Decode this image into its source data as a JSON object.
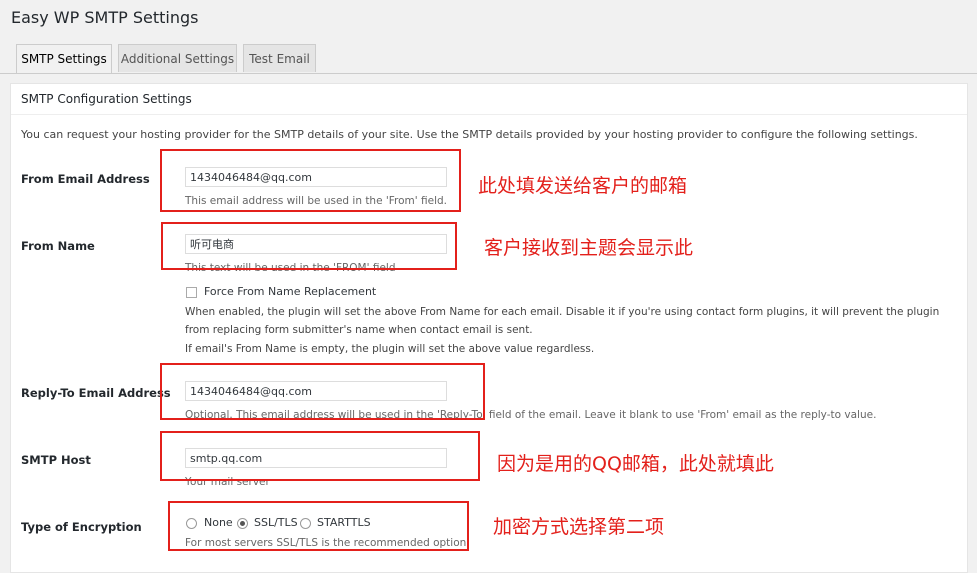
{
  "page": {
    "title": "Easy WP SMTP Settings"
  },
  "tabs": [
    {
      "label": "SMTP Settings",
      "active": true
    },
    {
      "label": "Additional Settings",
      "active": false
    },
    {
      "label": "Test Email",
      "active": false
    }
  ],
  "section": {
    "title": "SMTP Configuration Settings",
    "intro": "You can request your hosting provider for the SMTP details of your site. Use the SMTP details provided by your hosting provider to configure the following settings."
  },
  "fields": {
    "from_email": {
      "label": "From Email Address",
      "value": "1434046484@qq.com",
      "desc": "This email address will be used in the 'From' field."
    },
    "from_name": {
      "label": "From Name",
      "value": "听可电商",
      "desc": "This text will be used in the 'FROM' field",
      "force_label": "Force From Name Replacement",
      "force_checked": false,
      "help_1": "When enabled, the plugin will set the above From Name for each email. Disable it if you're using contact form plugins, it will prevent the plugin",
      "help_2": "from replacing form submitter's name when contact email is sent.",
      "help_3": "If email's From Name is empty, the plugin will set the above value regardless."
    },
    "reply_to": {
      "label": "Reply-To Email Address",
      "value": "1434046484@qq.com",
      "desc": "Optional. This email address will be used in the 'Reply-To' field of the email. Leave it blank to use 'From' email as the reply-to value."
    },
    "smtp_host": {
      "label": "SMTP Host",
      "value": "smtp.qq.com",
      "desc": "Your mail server"
    },
    "encryption": {
      "label": "Type of Encryption",
      "options": [
        "None",
        "SSL/TLS",
        "STARTTLS"
      ],
      "selected": "SSL/TLS",
      "desc": "For most servers SSL/TLS is the recommended option"
    }
  },
  "annotations": {
    "note_1": "此处填发送给客户的邮箱",
    "note_2": "客户接收到主题会显示此",
    "note_3": "因为是用的QQ邮箱，此处就填此",
    "note_4": "加密方式选择第二项",
    "color": "#e3201b"
  }
}
